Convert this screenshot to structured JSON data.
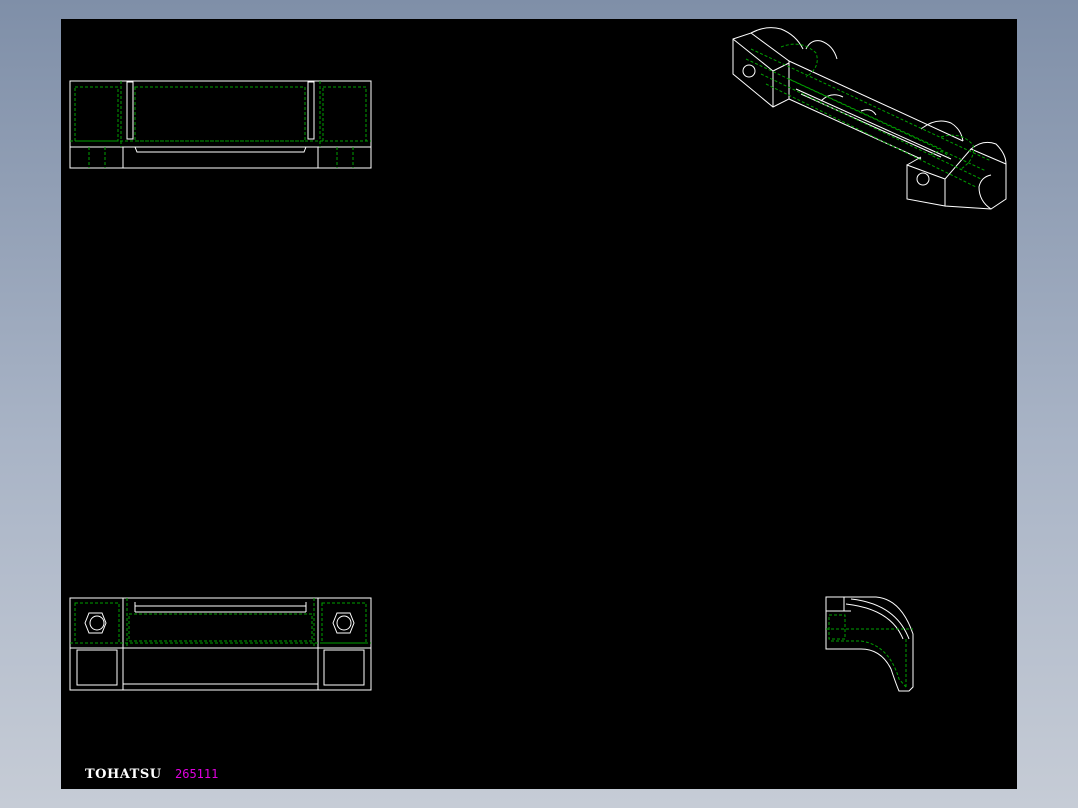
{
  "drawing": {
    "brand": "TOHATSU",
    "code": "265111"
  },
  "colors": {
    "frame_bg": "#8a99b2",
    "canvas": "#000000",
    "outline": "#ffffff",
    "hidden_line": "#00a000",
    "code_text": "#e000e0"
  },
  "views": [
    "top-view",
    "front-view",
    "side-view",
    "isometric-view"
  ]
}
